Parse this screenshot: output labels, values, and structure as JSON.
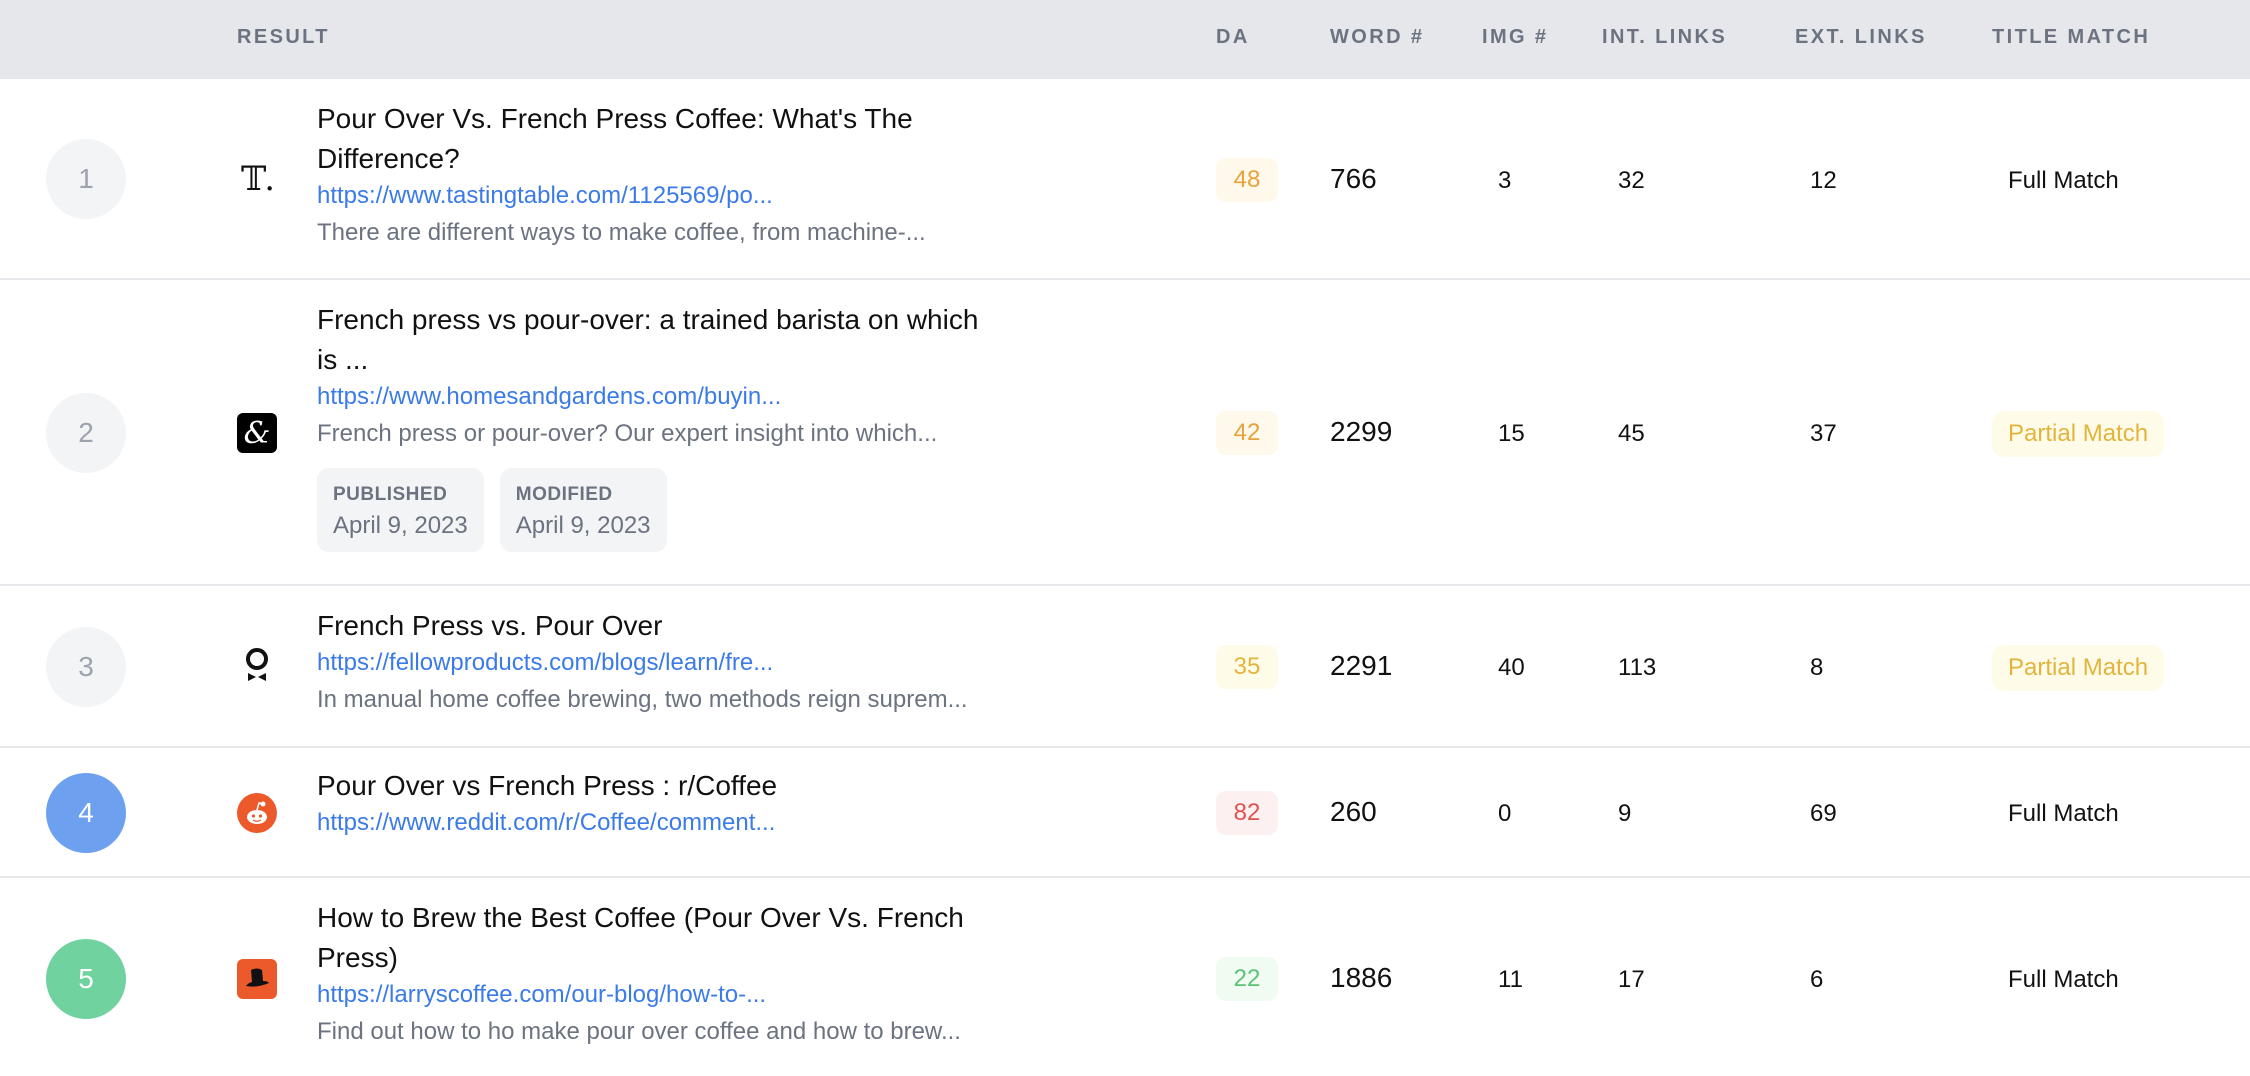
{
  "columns": {
    "result": "RESULT",
    "da": "DA",
    "word": "WORD #",
    "img": "IMG #",
    "int_links": "INT. LINKS",
    "ext_links": "EXT. LINKS",
    "title_match": "TITLE MATCH"
  },
  "date_labels": {
    "published": "PUBLISHED",
    "modified": "MODIFIED"
  },
  "rows": [
    {
      "rank": "1",
      "favicon": "tastingtable-icon",
      "title_line1": "Pour Over Vs. French Press Coffee: What's The",
      "title_line2": "Difference?",
      "url": "https://www.tastingtable.com/1125569/po...",
      "description": "There are different ways to make coffee, from machine-...",
      "da": "48",
      "da_color": "#e9a23b",
      "da_bg": "#fef9ea",
      "words": "766",
      "images": "3",
      "int_links": "32",
      "ext_links": "12",
      "title_match": "Full Match"
    },
    {
      "rank": "2",
      "favicon": "homesandgardens-icon",
      "title_line1": "French press vs pour-over: a trained barista on which",
      "title_line2": "is ...",
      "url": "https://www.homesandgardens.com/buyin...",
      "description": "French press or pour-over? Our expert insight into which...",
      "published": "April 9, 2023",
      "modified": "April 9, 2023",
      "da": "42",
      "da_color": "#e9a23b",
      "da_bg": "#fef9ea",
      "words": "2299",
      "images": "15",
      "int_links": "45",
      "ext_links": "37",
      "title_match": "Partial Match"
    },
    {
      "rank": "3",
      "favicon": "fellow-icon",
      "title_line1": "French Press vs. Pour Over",
      "url": "https://fellowproducts.com/blogs/learn/fre...",
      "description": "In manual home coffee brewing, two methods reign suprem...",
      "da": "35",
      "da_color": "#e3b43b",
      "da_bg": "#fefce8",
      "words": "2291",
      "images": "40",
      "int_links": "113",
      "ext_links": "8",
      "title_match": "Partial Match"
    },
    {
      "rank": "4",
      "favicon": "reddit-icon",
      "title_line1": "Pour Over vs French Press : r/Coffee",
      "url": "https://www.reddit.com/r/Coffee/comment...",
      "da": "82",
      "da_color": "#e0524f",
      "da_bg": "#fdf0f0",
      "words": "260",
      "images": "0",
      "int_links": "9",
      "ext_links": "69",
      "title_match": "Full Match"
    },
    {
      "rank": "5",
      "favicon": "larryscoffee-icon",
      "title_line1": "How to Brew the Best Coffee (Pour Over Vs. French",
      "title_line2": "Press)",
      "url": "https://larryscoffee.com/our-blog/how-to-...",
      "description": "Find out how to ho make pour over coffee and how to brew...",
      "da": "22",
      "da_color": "#5cc174",
      "da_bg": "#f0fbf2",
      "words": "1886",
      "images": "11",
      "int_links": "17",
      "ext_links": "6",
      "title_match": "Full Match"
    }
  ]
}
